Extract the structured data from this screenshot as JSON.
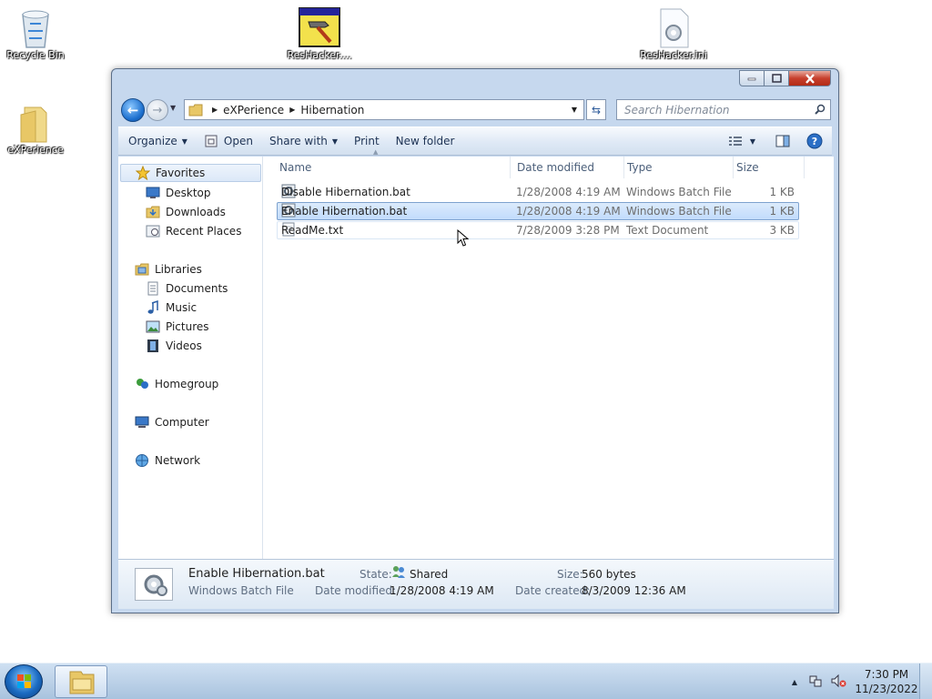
{
  "desktop": {
    "icons": [
      {
        "label": "Recycle Bin",
        "icon": "recycle-bin-icon"
      },
      {
        "label": "ResHacker....",
        "icon": "reshacker-app-icon"
      },
      {
        "label": "ResHacker.ini",
        "icon": "ini-settings-file-icon"
      },
      {
        "label": "eXPerience",
        "icon": "folder-icon"
      }
    ]
  },
  "window": {
    "address": {
      "crumbs": [
        "eXPerience",
        "Hibernation"
      ]
    },
    "search": {
      "placeholder": "Search Hibernation"
    },
    "toolbar": {
      "organize": "Organize",
      "open": "Open",
      "share_with": "Share with",
      "print": "Print",
      "new_folder": "New folder"
    },
    "nav": {
      "favorites": "Favorites",
      "desktop": "Desktop",
      "downloads": "Downloads",
      "recent_places": "Recent Places",
      "libraries": "Libraries",
      "documents": "Documents",
      "music": "Music",
      "pictures": "Pictures",
      "videos": "Videos",
      "homegroup": "Homegroup",
      "computer": "Computer",
      "network": "Network"
    },
    "columns": {
      "name": "Name",
      "date": "Date modified",
      "type": "Type",
      "size": "Size"
    },
    "files": [
      {
        "name": "Disable Hibernation.bat",
        "date": "1/28/2008 4:19 AM",
        "type": "Windows Batch File",
        "size": "1 KB",
        "icon": "batch-file-icon"
      },
      {
        "name": "Enable Hibernation.bat",
        "date": "1/28/2008 4:19 AM",
        "type": "Windows Batch File",
        "size": "1 KB",
        "icon": "batch-file-icon"
      },
      {
        "name": "ReadMe.txt",
        "date": "7/28/2009 3:28 PM",
        "type": "Text Document",
        "size": "3 KB",
        "icon": "text-file-icon"
      }
    ],
    "details": {
      "name": "Enable Hibernation.bat",
      "type": "Windows Batch File",
      "state_label": "State:",
      "state": "Shared",
      "modified_label": "Date modified:",
      "modified": "1/28/2008 4:19 AM",
      "size_label": "Size:",
      "size": "560 bytes",
      "created_label": "Date created:",
      "created": "8/3/2009 12:36 AM"
    }
  },
  "taskbar": {
    "time": "7:30 PM",
    "date": "11/23/2022"
  },
  "colors": {
    "accent": "#1c6fce",
    "selection": "#c1dbfc",
    "close": "#c7402d"
  }
}
